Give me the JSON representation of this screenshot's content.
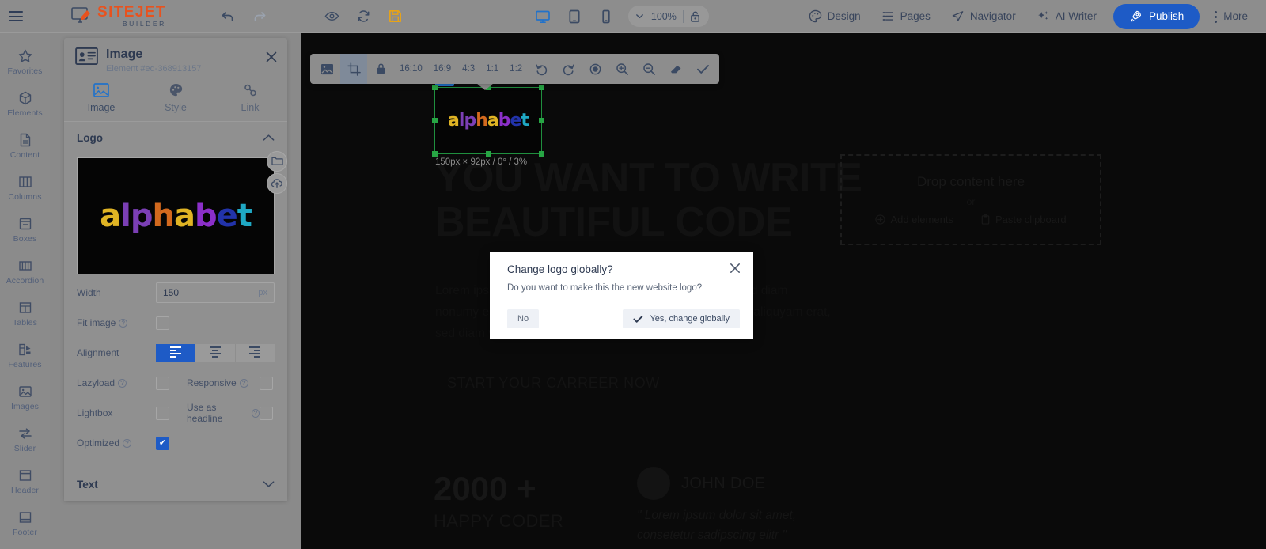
{
  "topbar": {
    "menu_icon": "hamburger-icon",
    "brand": {
      "name": "SITEJET",
      "sub": "BUILDER"
    },
    "undo_label": "undo-icon",
    "redo_label": "redo-icon",
    "preview_icon": "eye-icon",
    "reload_icon": "refresh-icon",
    "save_icon": "save-icon",
    "devices": [
      {
        "name": "desktop",
        "active": true
      },
      {
        "name": "tablet",
        "active": false
      },
      {
        "name": "mobile",
        "active": false
      }
    ],
    "zoom_value": "100%",
    "lock_icon": "unlock-icon",
    "actions": [
      {
        "label": "Design",
        "icon": "palette-icon"
      },
      {
        "label": "Pages",
        "icon": "list-icon"
      },
      {
        "label": "Navigator",
        "icon": "paper-plane-icon"
      },
      {
        "label": "AI Writer",
        "icon": "sparkle-icon"
      }
    ],
    "publish_label": "Publish",
    "more_label": "More"
  },
  "sidebar": {
    "items": [
      {
        "label": "Favorites",
        "icon": "star-icon"
      },
      {
        "label": "Elements",
        "icon": "cube-icon"
      },
      {
        "label": "Content",
        "icon": "document-icon"
      },
      {
        "label": "Columns",
        "icon": "columns-icon"
      },
      {
        "label": "Boxes",
        "icon": "box-icon"
      },
      {
        "label": "Accordion",
        "icon": "accordion-icon"
      },
      {
        "label": "Tables",
        "icon": "table-icon"
      },
      {
        "label": "Features",
        "icon": "features-icon"
      },
      {
        "label": "Images",
        "icon": "image-icon"
      },
      {
        "label": "Slider",
        "icon": "slider-icon"
      },
      {
        "label": "Header",
        "icon": "header-icon"
      },
      {
        "label": "Footer",
        "icon": "footer-icon"
      }
    ]
  },
  "panel": {
    "title": "Image",
    "subtitle": "Element #ed-368913157",
    "close_icon": "close-icon",
    "tabs": [
      {
        "label": "Image",
        "icon": "image-icon",
        "active": true
      },
      {
        "label": "Style",
        "icon": "palette-icon",
        "active": false
      },
      {
        "label": "Link",
        "icon": "link-icon",
        "active": false
      }
    ],
    "sections": [
      {
        "title": "Logo",
        "expanded": true
      },
      {
        "title": "Text",
        "expanded": false
      }
    ],
    "preview_alt": "alphabet",
    "preview_word": "alphabet",
    "float_buttons": [
      {
        "name": "browse-folder",
        "icon": "folder-icon"
      },
      {
        "name": "upload",
        "icon": "upload-icon"
      }
    ],
    "fields": {
      "width_label": "Width",
      "width_value": "150",
      "width_unit": "px",
      "fit_image_label": "Fit image",
      "fit_image_checked": false,
      "alignment_label": "Alignment",
      "alignment_selected": "left",
      "alignment_options": [
        "left",
        "center",
        "right"
      ],
      "lazyload_label": "Lazyload",
      "lazyload_checked": false,
      "responsive_label": "Responsive",
      "responsive_checked": false,
      "lightbox_label": "Lightbox",
      "lightbox_checked": false,
      "use_as_headline_label": "Use as headline",
      "use_as_headline_checked": false,
      "optimized_label": "Optimized",
      "optimized_checked": true
    }
  },
  "image_toolbar": {
    "buttons": [
      {
        "name": "image-mode",
        "icon": "image-icon",
        "active": false
      },
      {
        "name": "crop-mode",
        "icon": "crop-icon",
        "active": true
      },
      {
        "name": "lock-aspect",
        "icon": "lock-icon",
        "active": false
      }
    ],
    "ratios": [
      "16:10",
      "16:9",
      "4:3",
      "1:1",
      "1:2"
    ],
    "tools": [
      {
        "name": "rotate-left",
        "icon": "rotate-ccw-icon"
      },
      {
        "name": "rotate-right",
        "icon": "rotate-cw-icon"
      },
      {
        "name": "reset",
        "icon": "target-icon"
      },
      {
        "name": "zoom-in",
        "icon": "zoom-in-icon"
      },
      {
        "name": "zoom-out",
        "icon": "zoom-out-icon"
      },
      {
        "name": "eraser",
        "icon": "eraser-icon"
      },
      {
        "name": "apply",
        "icon": "check-icon"
      }
    ]
  },
  "canvas": {
    "selection_caption": "150px × 92px / 0° / 3%",
    "selected_word": "alphabet",
    "heading": "YOU WANT TO WRITE BEAUTIFUL CODE",
    "paragraph": "Lorem ipsum dolor sit amet, consetetur sadipscing elitr, sed diam nonumy eirmod tempor invidunt ut labore et dolore magna aliquyam erat, sed diam voluptua.",
    "cta": "START YOUR CARREER NOW",
    "stat_number": "2000 +",
    "stat_label": "HAPPY CODER",
    "author_name": "JOHN DOE",
    "quote": "\" Lorem ipsum dolor sit amet, consetetur sadipscing elitr \"",
    "dropzone": {
      "title": "Drop content here",
      "or": "or",
      "add_elements": "Add elements",
      "paste_clipboard": "Paste clipboard"
    }
  },
  "modal": {
    "title": "Change logo globally?",
    "body": "Do you want to make this the new website logo?",
    "close_icon": "close-icon",
    "no_label": "No",
    "yes_label": "Yes, change globally"
  },
  "colors": {
    "accent": "#1e5bc6",
    "brand": "#e8521e",
    "selection": "#27a544",
    "save": "#e8a317"
  },
  "logo_letters": [
    {
      "ch": "a",
      "color": "#e0b424"
    },
    {
      "ch": "l",
      "color": "#7b3fb5"
    },
    {
      "ch": "p",
      "color": "#7b3fb5"
    },
    {
      "ch": "h",
      "color": "#d2691e"
    },
    {
      "ch": "a",
      "color": "#e0b424"
    },
    {
      "ch": "b",
      "color": "#8b2fc9"
    },
    {
      "ch": "e",
      "color": "#2233aa"
    },
    {
      "ch": "t",
      "color": "#1fa8c4"
    }
  ]
}
